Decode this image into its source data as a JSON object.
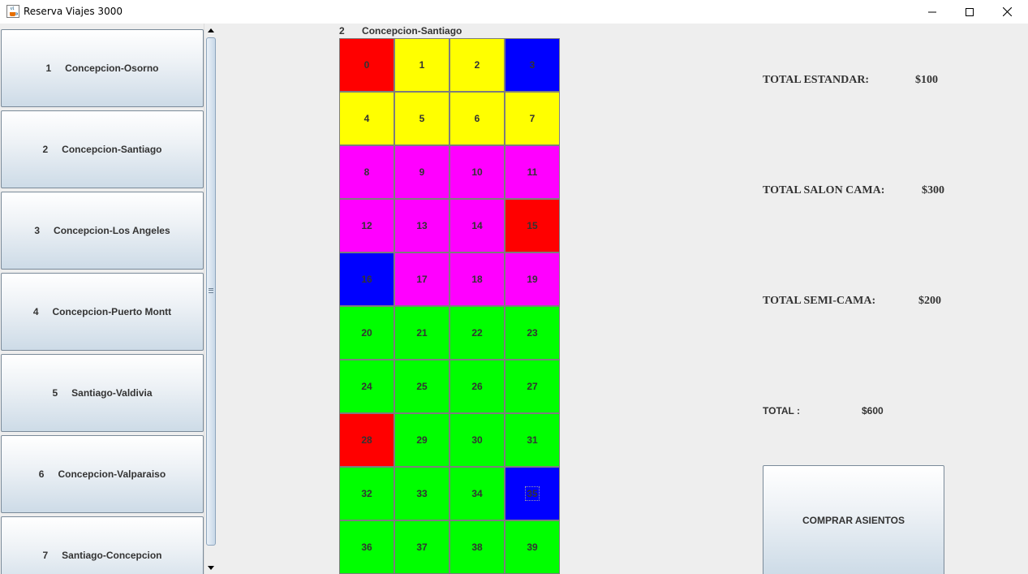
{
  "window": {
    "title": "Reserva Viajes 3000",
    "icon": "java-cup-icon"
  },
  "routes": [
    {
      "num": "1",
      "name": "Concepcion-Osorno"
    },
    {
      "num": "2",
      "name": "Concepcion-Santiago"
    },
    {
      "num": "3",
      "name": "Concepcion-Los Angeles"
    },
    {
      "num": "4",
      "name": "Concepcion-Puerto Montt"
    },
    {
      "num": "5",
      "name": "Santiago-Valdivia"
    },
    {
      "num": "6",
      "name": "Concepcion-Valparaiso"
    },
    {
      "num": "7",
      "name": "Santiago-Concepcion"
    }
  ],
  "selected_route": {
    "num": "2",
    "name": "Concepcion-Santiago"
  },
  "colors": {
    "red": "#ff0000",
    "yellow": "#ffff00",
    "blue": "#0000ff",
    "magenta": "#ff00ff",
    "green": "#00ff00"
  },
  "seats": [
    {
      "label": "0",
      "color": "#ff0000"
    },
    {
      "label": "1",
      "color": "#ffff00"
    },
    {
      "label": "2",
      "color": "#ffff00"
    },
    {
      "label": "3",
      "color": "#0000ff"
    },
    {
      "label": "4",
      "color": "#ffff00"
    },
    {
      "label": "5",
      "color": "#ffff00"
    },
    {
      "label": "6",
      "color": "#ffff00"
    },
    {
      "label": "7",
      "color": "#ffff00"
    },
    {
      "label": "8",
      "color": "#ff00ff"
    },
    {
      "label": "9",
      "color": "#ff00ff"
    },
    {
      "label": "10",
      "color": "#ff00ff"
    },
    {
      "label": "11",
      "color": "#ff00ff"
    },
    {
      "label": "12",
      "color": "#ff00ff"
    },
    {
      "label": "13",
      "color": "#ff00ff"
    },
    {
      "label": "14",
      "color": "#ff00ff"
    },
    {
      "label": "15",
      "color": "#ff0000"
    },
    {
      "label": "16",
      "color": "#0000ff"
    },
    {
      "label": "17",
      "color": "#ff00ff"
    },
    {
      "label": "18",
      "color": "#ff00ff"
    },
    {
      "label": "19",
      "color": "#ff00ff"
    },
    {
      "label": "20",
      "color": "#00ff00"
    },
    {
      "label": "21",
      "color": "#00ff00"
    },
    {
      "label": "22",
      "color": "#00ff00"
    },
    {
      "label": "23",
      "color": "#00ff00"
    },
    {
      "label": "24",
      "color": "#00ff00"
    },
    {
      "label": "25",
      "color": "#00ff00"
    },
    {
      "label": "26",
      "color": "#00ff00"
    },
    {
      "label": "27",
      "color": "#00ff00"
    },
    {
      "label": "28",
      "color": "#ff0000"
    },
    {
      "label": "29",
      "color": "#00ff00"
    },
    {
      "label": "30",
      "color": "#00ff00"
    },
    {
      "label": "31",
      "color": "#00ff00"
    },
    {
      "label": "32",
      "color": "#00ff00"
    },
    {
      "label": "33",
      "color": "#00ff00"
    },
    {
      "label": "34",
      "color": "#00ff00"
    },
    {
      "label": "35",
      "color": "#0000ff",
      "focused": true
    },
    {
      "label": "36",
      "color": "#00ff00"
    },
    {
      "label": "37",
      "color": "#00ff00"
    },
    {
      "label": "38",
      "color": "#00ff00"
    },
    {
      "label": "39",
      "color": "#00ff00"
    }
  ],
  "totals": {
    "estandar_label": "TOTAL ESTANDAR:",
    "estandar_value": "$100",
    "salon_cama_label": "TOTAL SALON CAMA:",
    "salon_cama_value": "$300",
    "semi_cama_label": "TOTAL SEMI-CAMA:",
    "semi_cama_value": "$200",
    "total_label": "TOTAL :",
    "total_value": "$600"
  },
  "buy_button_label": "COMPRAR ASIENTOS"
}
